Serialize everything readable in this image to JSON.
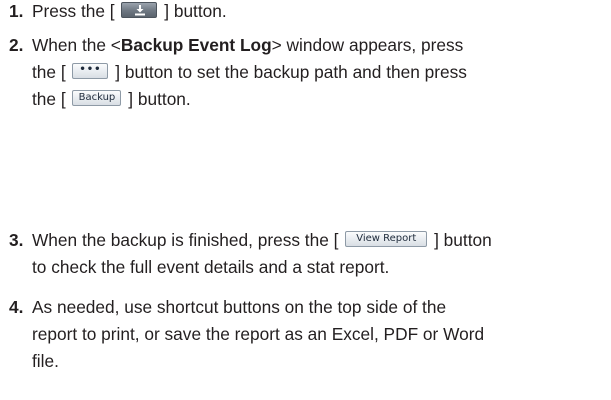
{
  "steps": [
    {
      "number": "1.",
      "before": "Press the [",
      "after": "] button."
    },
    {
      "number": "2.",
      "part1": "When the <",
      "bold": "Backup Event Log",
      "part2": "> window appears, press",
      "part3": "the [",
      "part4": "] button to set the backup path and then press",
      "part5": "the [",
      "part6": "] button."
    },
    {
      "number": "3.",
      "part1": "When the backup is finished, press the [",
      "part2": "] button",
      "part3": "to check the full event details and a stat report."
    },
    {
      "number": "4.",
      "line1": "As needed, use shortcut buttons on the top side of the",
      "line2": "report to print, or save the report as an Excel, PDF or Word",
      "line3": "file."
    }
  ],
  "buttons": {
    "download_icon": "download-icon",
    "browse_label": "•••",
    "backup_label": "Backup",
    "view_report_label": "View Report"
  }
}
